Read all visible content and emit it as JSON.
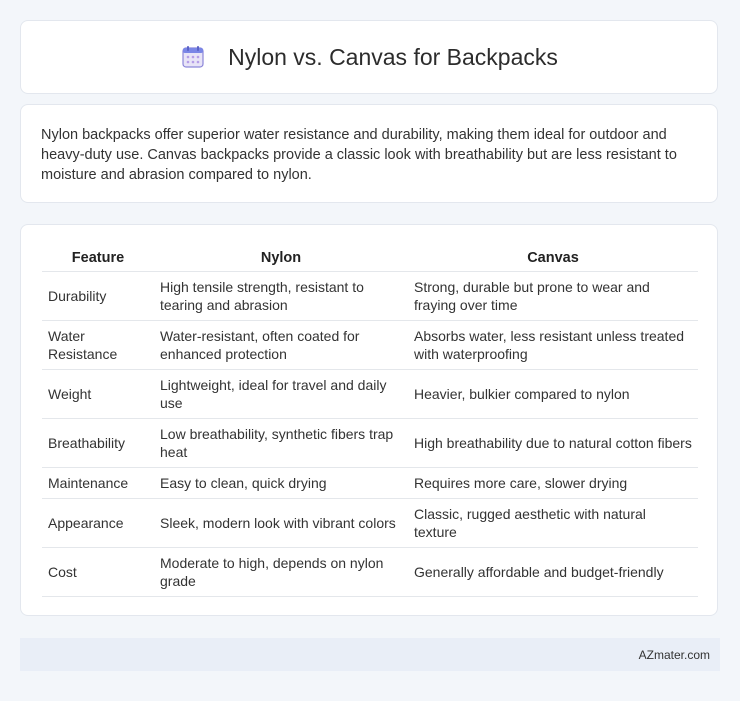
{
  "header": {
    "title": "Nylon vs. Canvas for Backpacks",
    "icon": "calendar-icon"
  },
  "intro": {
    "text": "Nylon backpacks offer superior water resistance and durability, making them ideal for outdoor and heavy-duty use. Canvas backpacks provide a classic look with breathability but are less resistant to moisture and abrasion compared to nylon."
  },
  "table": {
    "headers": [
      "Feature",
      "Nylon",
      "Canvas"
    ],
    "rows": [
      {
        "feature": "Durability",
        "nylon": "High tensile strength, resistant to tearing and abrasion",
        "canvas": "Strong, durable but prone to wear and fraying over time"
      },
      {
        "feature": "Water Resistance",
        "nylon": "Water-resistant, often coated for enhanced protection",
        "canvas": "Absorbs water, less resistant unless treated with waterproofing"
      },
      {
        "feature": "Weight",
        "nylon": "Lightweight, ideal for travel and daily use",
        "canvas": "Heavier, bulkier compared to nylon"
      },
      {
        "feature": "Breathability",
        "nylon": "Low breathability, synthetic fibers trap heat",
        "canvas": "High breathability due to natural cotton fibers"
      },
      {
        "feature": "Maintenance",
        "nylon": "Easy to clean, quick drying",
        "canvas": "Requires more care, slower drying"
      },
      {
        "feature": "Appearance",
        "nylon": "Sleek, modern look with vibrant colors",
        "canvas": "Classic, rugged aesthetic with natural texture"
      },
      {
        "feature": "Cost",
        "nylon": "Moderate to high, depends on nylon grade",
        "canvas": "Generally affordable and budget-friendly"
      }
    ]
  },
  "footer": {
    "text": "AZmater.com"
  }
}
